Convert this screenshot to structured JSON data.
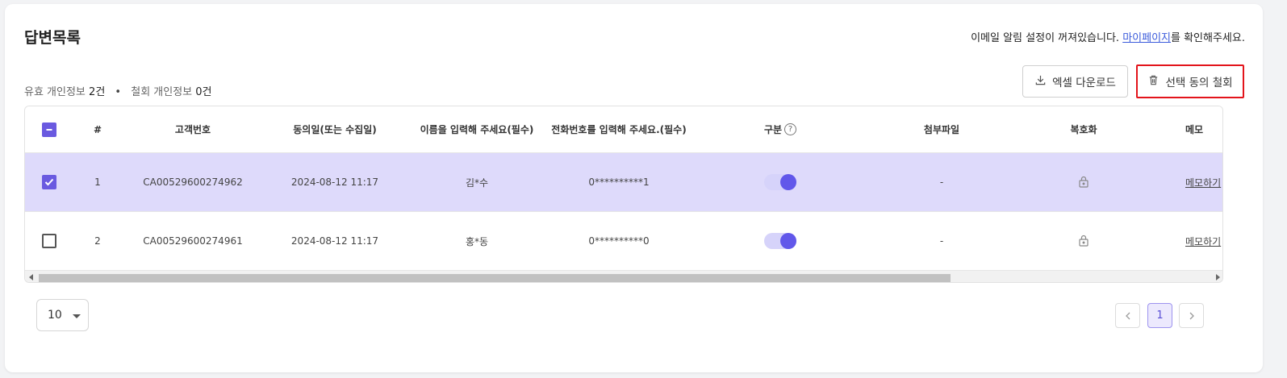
{
  "page": {
    "title": "답변목록",
    "notice_prefix": "이메일 알림 설정이 꺼져있습니다. ",
    "notice_link": "마이페이지",
    "notice_suffix": "를 확인해주세요."
  },
  "summary": {
    "valid_label": "유효 개인정보",
    "valid_count": "2건",
    "withdrawn_label": "철회 개인정보",
    "withdrawn_count": "0건"
  },
  "actions": {
    "excel_download": "엑셀 다운로드",
    "withdraw_selected": "선택 동의 철회"
  },
  "table": {
    "columns": {
      "no": "#",
      "customer_no": "고객번호",
      "consent_date": "동의일(또는 수집일)",
      "name": "이름을 입력해 주세요(필수)",
      "phone": "전화번호를 입력해 주세요.(필수)",
      "type": "구분",
      "attachment": "첨부파일",
      "decrypt": "복호화",
      "memo": "메모"
    },
    "rows": [
      {
        "no": "1",
        "customer_no": "CA00529600274962",
        "consent_date": "2024-08-12 11:17",
        "name": "김*수",
        "phone": "0**********1",
        "attachment": "-",
        "memo": "메모하기",
        "checked": true,
        "type_on": true
      },
      {
        "no": "2",
        "customer_no": "CA00529600274961",
        "consent_date": "2024-08-12 11:17",
        "name": "홍*동",
        "phone": "0**********0",
        "attachment": "-",
        "memo": "메모하기",
        "checked": false,
        "type_on": true
      }
    ]
  },
  "pagination": {
    "page_size": "10",
    "current_page": "1"
  },
  "colors": {
    "accent": "#6a5ae0",
    "selected_row": "#dedafb",
    "link": "#3b5bdb",
    "highlight_border": "#e3141b"
  },
  "icons": {
    "download": "download-icon",
    "trash": "trash-icon",
    "help": "question-circle-icon",
    "lock": "lock-icon"
  }
}
